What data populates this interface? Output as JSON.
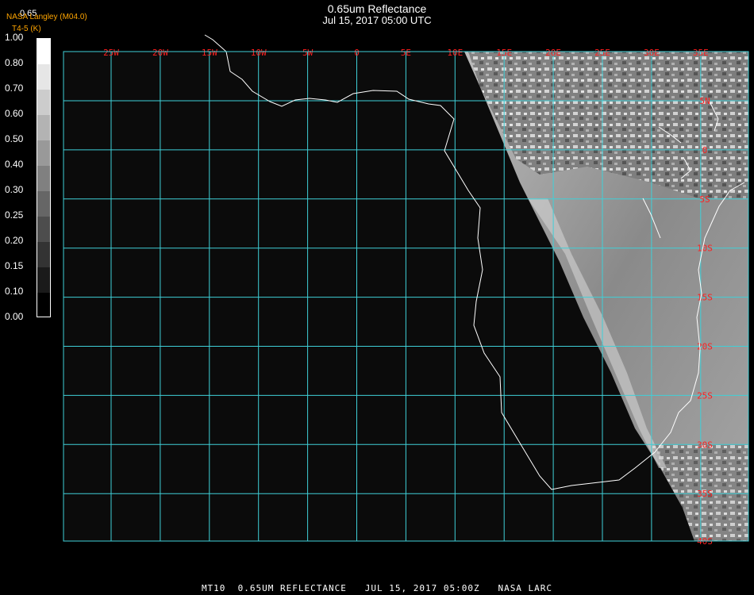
{
  "header": {
    "title": "0.65um Reflectance",
    "subtitle": "Jul 15, 2017 05:00 UTC",
    "credit": "NASA Langley (M04.0)",
    "units": "T4-5 (K)",
    "scale_top": "0.65"
  },
  "colorbar": {
    "labels": [
      "1.00",
      "0.80",
      "0.70",
      "0.60",
      "0.50",
      "0.40",
      "0.30",
      "0.25",
      "0.20",
      "0.15",
      "0.10",
      "0.00"
    ]
  },
  "map": {
    "lon_labels": [
      "25W",
      "20W",
      "15W",
      "10W",
      "5W",
      "0",
      "5E",
      "10E",
      "15E",
      "20E",
      "25E",
      "30E",
      "35E"
    ],
    "lat_labels": [
      "5N",
      "0",
      "5S",
      "10S",
      "15S",
      "20S",
      "25S",
      "30S",
      "35S",
      "40S"
    ],
    "grid_color": "#3fd0d8",
    "label_color": "#ff2020",
    "coast_color": "#ffffff"
  },
  "footer": {
    "caption": "MT10  0.65UM REFLECTANCE   JUL 15, 2017 05:00Z   NASA LARC"
  }
}
